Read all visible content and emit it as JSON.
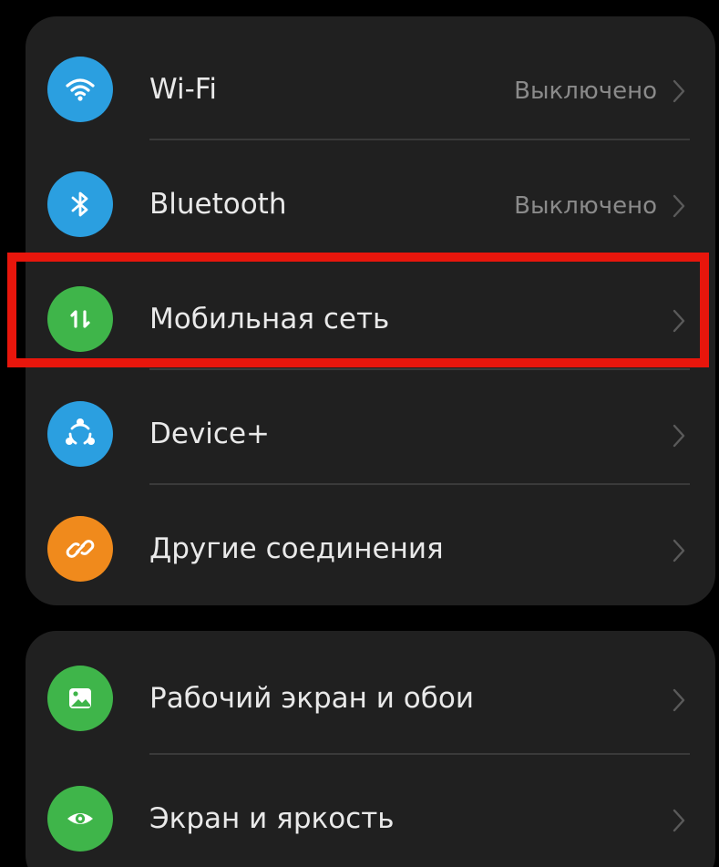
{
  "groups": [
    {
      "items": [
        {
          "label": "Wi-Fi",
          "value": "Выключено",
          "icon": "wifi-icon",
          "icon_color": "#2b9fe0"
        },
        {
          "label": "Bluetooth",
          "value": "Выключено",
          "icon": "bluetooth-icon",
          "icon_color": "#2b9fe0"
        },
        {
          "label": "Мобильная сеть",
          "value": "",
          "icon": "mobile-data-icon",
          "icon_color": "#3fb54a"
        },
        {
          "label": "Device+",
          "value": "",
          "icon": "device-plus-icon",
          "icon_color": "#2b9fe0"
        },
        {
          "label": "Другие соединения",
          "value": "",
          "icon": "link-icon",
          "icon_color": "#f08a1c"
        }
      ]
    },
    {
      "items": [
        {
          "label": "Рабочий экран и обои",
          "value": "",
          "icon": "wallpaper-icon",
          "icon_color": "#3fb54a"
        },
        {
          "label": "Экран и яркость",
          "value": "",
          "icon": "eye-icon",
          "icon_color": "#3fb54a"
        }
      ]
    }
  ],
  "highlight": {
    "target": "Мобильная сеть",
    "color": "#e8160c"
  },
  "colors": {
    "background": "#000000",
    "card": "#202020",
    "text": "#e9e9e9",
    "secondary_text": "#8a8a8a",
    "divider": "#3a3a3a"
  }
}
